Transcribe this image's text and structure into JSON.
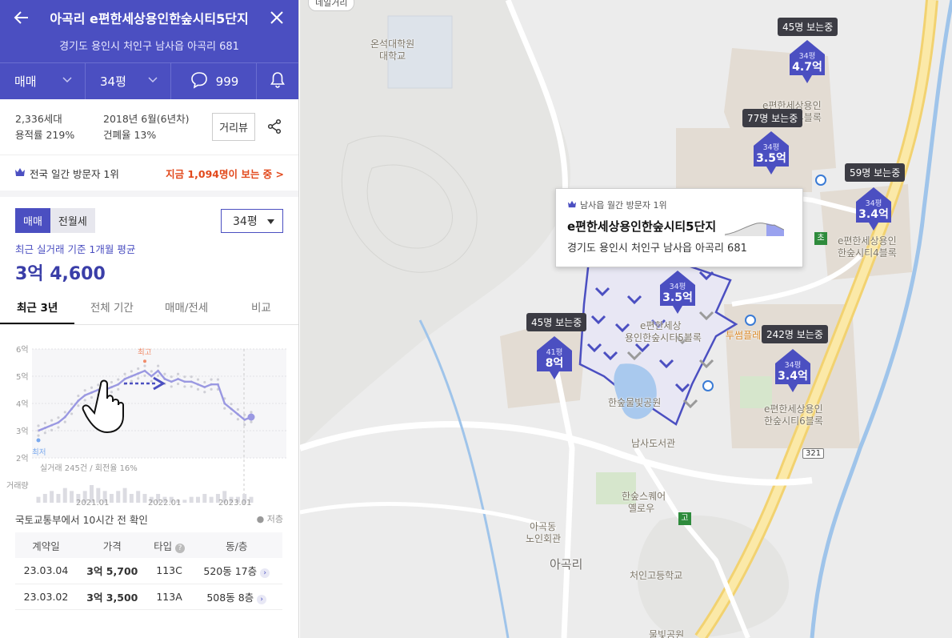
{
  "header": {
    "title": "아곡리 e편한세상용인한숲시티5단지",
    "address": "경기도 용인시 처인구 남사읍 아곡리 681",
    "tabs": [
      {
        "label": "매매"
      },
      {
        "label": "34평"
      },
      {
        "label": "999"
      }
    ]
  },
  "info": {
    "households": "2,336세대",
    "floor_area_ratio": "용적률 219%",
    "built": "2018년 6월(6년차)",
    "coverage_ratio": "건폐율 13%",
    "street_view_label": "거리뷰"
  },
  "ranking": {
    "label": "전국 일간 방문자 1위",
    "live_viewers": "지금 1,094명이 보는 중 >"
  },
  "filters": {
    "segments": [
      "매매",
      "전월세"
    ],
    "type_select": "34평"
  },
  "price": {
    "caption": "최근 실거래 기준 1개월 평균",
    "value": "3억 4,600"
  },
  "period_tabs": [
    "최근 3년",
    "전체 기간",
    "매매/전세",
    "비교"
  ],
  "chart_data": {
    "type": "line",
    "y_ticks": [
      "6억",
      "5억",
      "4억",
      "3억",
      "2억"
    ],
    "ylim": [
      2,
      6
    ],
    "x_ticks": [
      "2021.01",
      "2022.01",
      "2023.01"
    ],
    "series": [
      {
        "values": [
          3.0,
          3.1,
          3.2,
          3.3,
          3.5,
          3.8,
          4.1,
          4.3,
          4.4,
          4.5,
          4.5,
          4.6,
          4.7,
          4.9,
          5.0,
          5.1,
          5.2,
          5.0,
          5.2,
          4.9,
          4.8,
          4.9,
          4.8,
          4.8,
          4.7,
          4.6,
          4.7,
          4.7,
          4.0,
          3.8,
          3.6,
          3.4,
          3.5
        ]
      }
    ],
    "annotations": {
      "high": "최고",
      "low": "최저"
    },
    "volume_label": "거래량",
    "volume": [
      2,
      3,
      4,
      3,
      5,
      4,
      3,
      4,
      6,
      5,
      4,
      3,
      4,
      5,
      3,
      4,
      3,
      2,
      3,
      2,
      2,
      1,
      1,
      2,
      2,
      3,
      2,
      3,
      4,
      2,
      2,
      3,
      2
    ],
    "footer": "실거래 245건 / 회전율 16%"
  },
  "confirm": {
    "text": "국토교통부에서 10시간 전 확인",
    "lowest_legend": "● 저층"
  },
  "transactions": {
    "headers": [
      "계약일",
      "가격",
      "타입",
      "동/층"
    ],
    "rows": [
      {
        "date": "23.03.04",
        "price": "3억 5,700",
        "type": "113C",
        "unit": "520동 17층"
      },
      {
        "date": "23.03.02",
        "price": "3억 3,500",
        "type": "113A",
        "unit": "508동 8층"
      }
    ]
  },
  "map": {
    "popup": {
      "rank": "남사읍 월간 방문자 1위",
      "name": "e편한세상용인한숲시티5단지",
      "address": "경기도 용인시 처인구 남사읍 아곡리 681"
    },
    "markers": [
      {
        "viewers": "45명 보는중",
        "size": "34평",
        "price": "4.7억"
      },
      {
        "viewers": "77명 보는중",
        "size": "34평",
        "price": "3.5억"
      },
      {
        "viewers": "59명 보는중",
        "size": "34평",
        "price": "3.4억"
      },
      {
        "viewers": "",
        "size": "34평",
        "price": "3.5억"
      },
      {
        "viewers": "45명 보는중",
        "size": "41평",
        "price": "8억"
      },
      {
        "viewers": "242명 보는중",
        "size": "34평",
        "price": "3.4억"
      }
    ],
    "labels": {
      "univ": "온석대학원\n대학교",
      "c4_top": "e편한세상용인",
      "c4_bot": "한숲시티4블록",
      "c3_top": "e편한세상용인",
      "c3_bot": "한숲시티6블록",
      "c5_top": "e편한세상",
      "c5_bot": "용인한숲시티5블록",
      "park": "한숲물빛공원",
      "library": "남사도서관",
      "square1": "한숲스퀘어",
      "square2": "옐로우",
      "senior1": "아곡동",
      "senior2": "노인회관",
      "village": "아곡리",
      "high": "처인고등학교",
      "park2": "물빛공원",
      "market": "투썸플레",
      "route": "321",
      "elem": "초",
      "high_sign": "고",
      "top_tag": "네일거리"
    }
  },
  "colors": {
    "brand": "#4b4fc1",
    "accent": "#e2491c"
  }
}
